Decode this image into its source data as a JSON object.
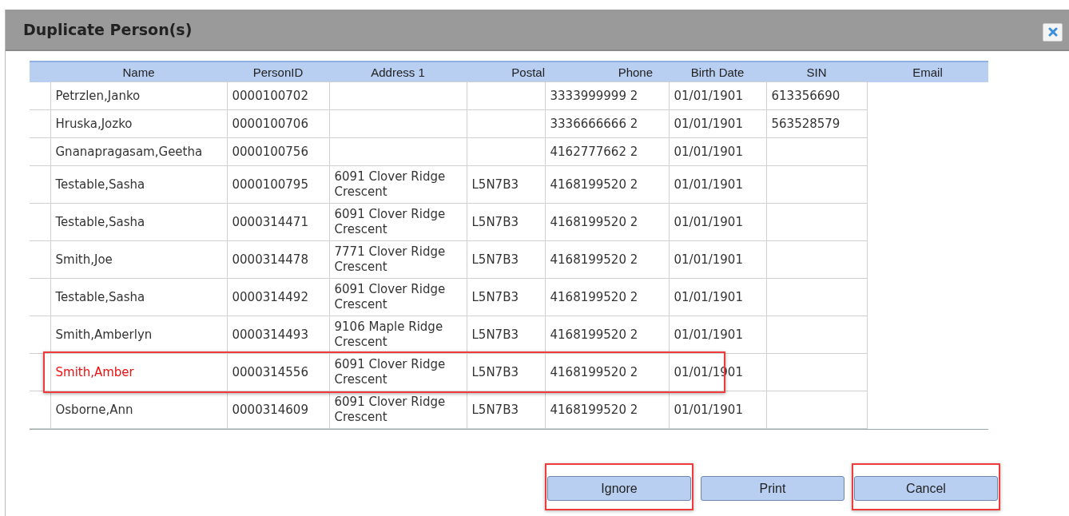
{
  "dialog": {
    "title": "Duplicate Person(s)"
  },
  "table": {
    "columns": [
      "Name",
      "PersonID",
      "Address 1",
      "Postal",
      "Phone",
      "Birth Date",
      "SIN",
      "Email"
    ],
    "rows": [
      {
        "cells": [
          "Petrzlen,Janko",
          "0000100702",
          "",
          "",
          "3333999999 2",
          "01/01/1901",
          "613356690"
        ],
        "highlighted": false
      },
      {
        "cells": [
          "Hruska,Jozko",
          "0000100706",
          "",
          "",
          "3336666666 2",
          "01/01/1901",
          "563528579"
        ],
        "highlighted": false
      },
      {
        "cells": [
          "Gnanapragasam,Geetha",
          "0000100756",
          "",
          "",
          "4162777662 2",
          "01/01/1901",
          ""
        ],
        "highlighted": false
      },
      {
        "cells": [
          "Testable,Sasha",
          "0000100795",
          "6091 Clover Ridge Crescent",
          "L5N7B3",
          "4168199520 2",
          "01/01/1901",
          ""
        ],
        "highlighted": false
      },
      {
        "cells": [
          "Testable,Sasha",
          "0000314471",
          "6091 Clover Ridge Crescent",
          "L5N7B3",
          "4168199520 2",
          "01/01/1901",
          ""
        ],
        "highlighted": false
      },
      {
        "cells": [
          "Smith,Joe",
          "0000314478",
          "7771 Clover Ridge Crescent",
          "L5N7B3",
          "4168199520 2",
          "01/01/1901",
          ""
        ],
        "highlighted": false
      },
      {
        "cells": [
          "Testable,Sasha",
          "0000314492",
          "6091 Clover Ridge Crescent",
          "L5N7B3",
          "4168199520 2",
          "01/01/1901",
          ""
        ],
        "highlighted": false
      },
      {
        "cells": [
          "Smith,Amberlyn",
          "0000314493",
          "9106 Maple Ridge Crescent",
          "L5N7B3",
          "4168199520 2",
          "01/01/1901",
          ""
        ],
        "highlighted": false
      },
      {
        "cells": [
          "Smith,Amber",
          "0000314556",
          "6091 Clover Ridge Crescent",
          "L5N7B3",
          "4168199520 2",
          "01/01/1901",
          ""
        ],
        "highlighted": true
      },
      {
        "cells": [
          "Osborne,Ann",
          "0000314609",
          "6091 Clover Ridge Crescent",
          "L5N7B3",
          "4168199520 2",
          "01/01/1901",
          ""
        ],
        "highlighted": false
      }
    ]
  },
  "buttons": [
    {
      "label": "Ignore",
      "highlighted": true
    },
    {
      "label": "Print",
      "highlighted": false
    },
    {
      "label": "Cancel",
      "highlighted": true
    }
  ]
}
